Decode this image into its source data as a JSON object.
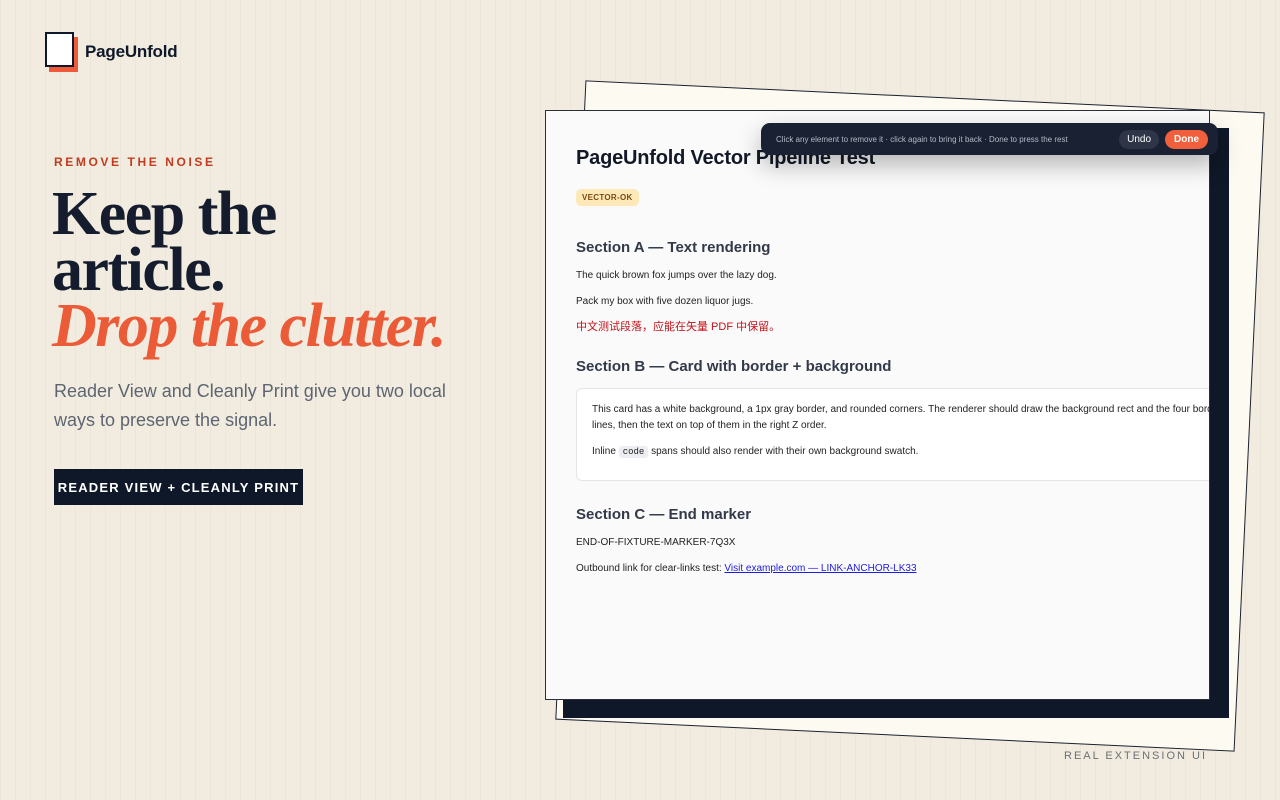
{
  "brand": {
    "name": "PageUnfold"
  },
  "hero": {
    "eyebrow": "REMOVE THE NOISE",
    "headline_line1": "Keep the",
    "headline_line2": "article.",
    "headline_accent": "Drop the clutter.",
    "subtitle": "Reader View and Cleanly Print give you two local ways to preserve the signal.",
    "cta_label": "READER VIEW + CLEANLY PRINT"
  },
  "preview": {
    "title": "PageUnfold Vector Pipeline Test",
    "badge": "VECTOR-OK",
    "section_a": {
      "heading": "Section A — Text rendering",
      "lines": [
        "The quick brown fox jumps over the lazy dog.",
        "Pack my box with five dozen liquor jugs."
      ],
      "cjk_line": "中文测试段落，应能在矢量 PDF 中保留。"
    },
    "section_b": {
      "heading": "Section B — Card with border + background",
      "card_text": "This card has a white background, a 1px gray border, and rounded corners. The renderer should draw the background rect and the four border lines, then the text on top of them in the right Z order.",
      "inline_prefix": "Inline",
      "inline_code": "code",
      "inline_suffix": "spans should also render with their own background swatch."
    },
    "section_c": {
      "heading": "Section C — End marker",
      "marker": "END-OF-FIXTURE-MARKER-7Q3X",
      "link_prefix": "Outbound link for clear-links test:",
      "link_text": "Visit example.com — LINK-ANCHOR-LK33"
    }
  },
  "toolbar": {
    "hint": "Click any element to remove it · click again to bring it back · Done to press the rest",
    "undo_label": "Undo",
    "done_label": "Done"
  },
  "caption": "REAL EXTENSION UI",
  "colors": {
    "background": "#f1ecdf",
    "navy": "#0f1828",
    "accent": "#ec5b37",
    "eyebrow": "#c53a1e"
  }
}
